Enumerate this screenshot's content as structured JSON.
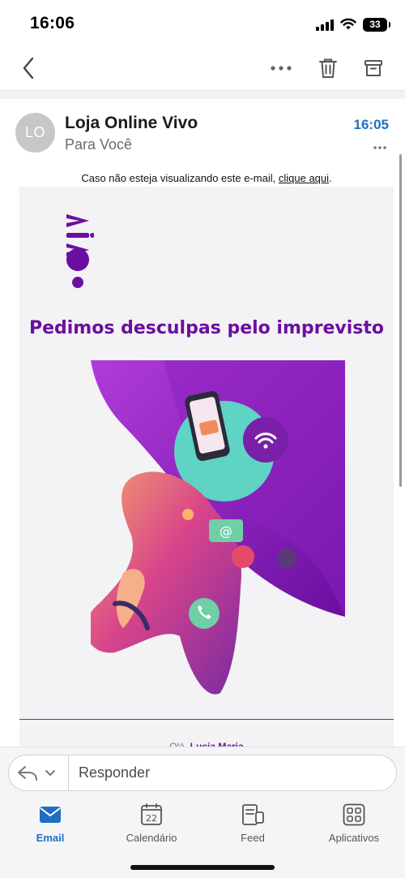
{
  "status_bar": {
    "time": "16:06",
    "battery": "33"
  },
  "toolbar": {
    "back_icon": "chevron-left-icon",
    "more_icon": "ellipsis-icon",
    "delete_icon": "trash-icon",
    "archive_icon": "archive-icon"
  },
  "message": {
    "avatar_initials": "LO",
    "sender": "Loja Online Vivo",
    "recipient": "Para Você",
    "time": "16:05",
    "time_color": "#1f6fc1"
  },
  "email": {
    "view_notice": "Caso não esteja visualizando este e-mail,",
    "view_link": "clique aqui",
    "view_suffix": ".",
    "brand_logo": "vivo",
    "headline": "Pedimos desculpas pelo imprevisto",
    "headline_color": "#6b0fa0",
    "greeting_prefix": "Olá,",
    "greeting_name": "Lucia Maria"
  },
  "reply": {
    "label": "Responder"
  },
  "tabs": [
    {
      "label": "Email",
      "icon": "mail-icon",
      "active": true
    },
    {
      "label": "Calendário",
      "icon": "calendar-icon",
      "day": "22"
    },
    {
      "label": "Feed",
      "icon": "feed-icon"
    },
    {
      "label": "Aplicativos",
      "icon": "apps-grid-icon"
    }
  ]
}
